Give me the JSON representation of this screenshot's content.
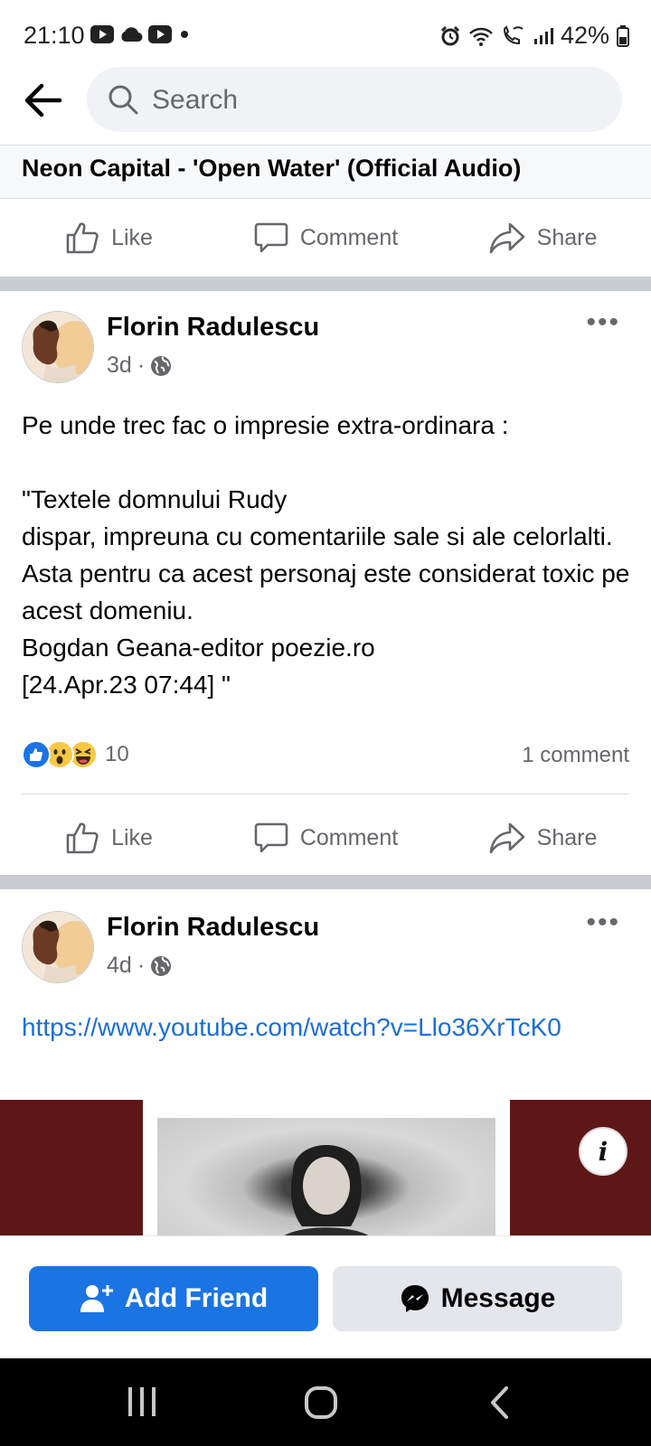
{
  "status_bar": {
    "time": "21:10",
    "left_icons": [
      "youtube-icon",
      "cloud-icon",
      "youtube-icon",
      "dot-icon"
    ],
    "right_icons": [
      "alarm-icon",
      "wifi-icon",
      "wifi-call-icon",
      "signal-icon"
    ],
    "battery": "42%"
  },
  "header": {
    "search_placeholder": "Search"
  },
  "prev_post": {
    "title": "Neon Capital - 'Open Water' (Official Audio)",
    "actions": {
      "like": "Like",
      "comment": "Comment",
      "share": "Share"
    }
  },
  "post1": {
    "author": "Florin Radulescu",
    "time": "3d",
    "separator": "·",
    "text": "Pe unde trec fac o impresie extra-ordinara :\n\n\"Textele domnului Rudy\ndispar, impreuna cu comentariile sale si ale celorlalti. Asta pentru ca acest personaj este considerat toxic pe acest domeniu.\nBogdan Geana-editor poezie.ro\n[24.Apr.23 07:44] \"",
    "reaction_count": "10",
    "comment_count": "1 comment",
    "actions": {
      "like": "Like",
      "comment": "Comment",
      "share": "Share"
    }
  },
  "post2": {
    "author": "Florin Radulescu",
    "time": "4d",
    "separator": "·",
    "link": "https://www.youtube.com/watch?v=Llo36XrTcK0",
    "info": "i"
  },
  "bottom": {
    "add_friend": "Add Friend",
    "message": "Message"
  },
  "colors": {
    "accent": "#1b74e4",
    "link": "#1a6ed8",
    "media_bg": "#5e1717"
  }
}
